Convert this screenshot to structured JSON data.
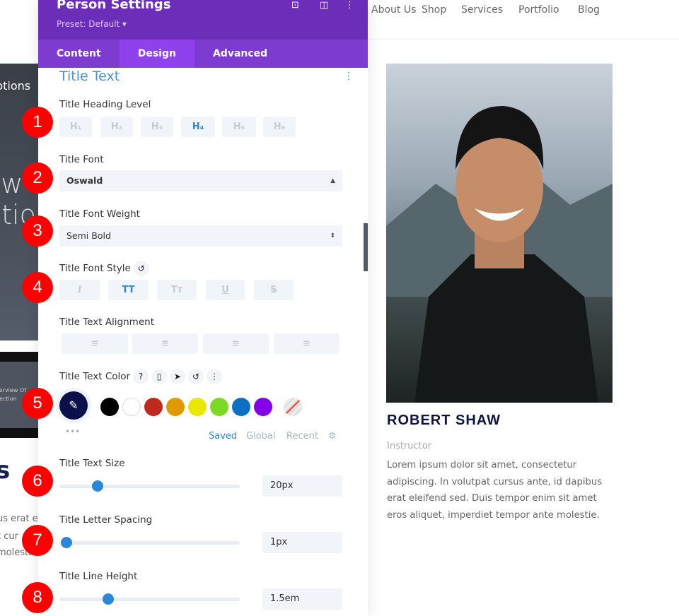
{
  "site_nav": {
    "items": [
      "About Us",
      "Shop",
      "Services",
      "Portfolio",
      "Blog"
    ]
  },
  "background": {
    "left_fragments": [
      "ptions",
      "ow",
      "ptio",
      "verview Of",
      "Section",
      "s",
      "us erat e",
      "t cur",
      "molestie"
    ]
  },
  "panel": {
    "title": "Person Settings",
    "preset": "Preset: Default ▾",
    "header_icons": [
      "focus-icon",
      "split-view-icon",
      "more-icon"
    ],
    "tabs": [
      {
        "label": "Content"
      },
      {
        "label": "Design",
        "active": true
      },
      {
        "label": "Advanced"
      }
    ],
    "section_title": "Title Text",
    "heading_level": {
      "label": "Title Heading Level",
      "options": [
        "H₁",
        "H₂",
        "H₃",
        "H₄",
        "H₅",
        "H₆"
      ],
      "selected": "H₄"
    },
    "font": {
      "label": "Title Font",
      "value": "Oswald"
    },
    "font_weight": {
      "label": "Title Font Weight",
      "value": "Semi Bold"
    },
    "font_style": {
      "label": "Title Font Style",
      "options": [
        "I",
        "TT",
        "Tт",
        "U",
        "S"
      ],
      "selected": "TT"
    },
    "alignment": {
      "label": "Title Text Alignment"
    },
    "text_color": {
      "label": "Title Text Color",
      "current": "#0b0f4a",
      "swatches": [
        "#000000",
        "#ffffff",
        "#c0291e",
        "#e09900",
        "#e8e800",
        "#7cda24",
        "#0c71c3",
        "#8300e9"
      ],
      "tabs": [
        "Saved",
        "Global",
        "Recent"
      ],
      "active_tab": "Saved"
    },
    "text_size": {
      "label": "Title Text Size",
      "value": "20px",
      "fraction": 0.21
    },
    "letter_spacing": {
      "label": "Title Letter Spacing",
      "value": "1px",
      "fraction": 0.04
    },
    "line_height": {
      "label": "Title Line Height",
      "value": "1.5em",
      "fraction": 0.27
    }
  },
  "badges": [
    "1",
    "2",
    "3",
    "4",
    "5",
    "6",
    "7",
    "8"
  ],
  "person": {
    "name": "ROBERT SHAW",
    "position": "Instructor",
    "bio": "Lorem ipsum dolor sit amet, consectetur adipiscing. In volutpat cursus ante, id dapibus erat eleifend sed. Duis tempor enim sit amet eros aliquet, imperdiet tempor ante molestie."
  },
  "accent": "#2b87da"
}
